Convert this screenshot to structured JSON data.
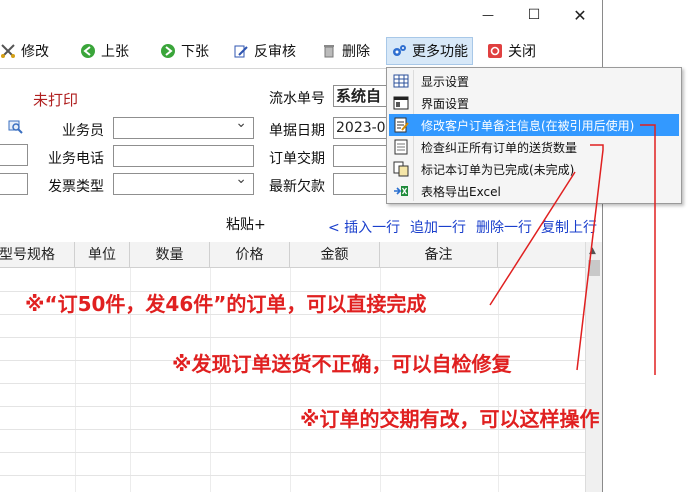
{
  "window": {
    "close_glyph": "✕",
    "max_glyph": "☐",
    "min_glyph": "—"
  },
  "toolbar": {
    "modify": "修改",
    "prev": "上张",
    "next": "下张",
    "unreview": "反审核",
    "delete": "删除",
    "more": "更多功能",
    "close": "关闭"
  },
  "form": {
    "print_status": "未打印",
    "salesman_label": "业务员",
    "salesman_value": "",
    "phone_label": "业务电话",
    "phone_value": "",
    "invoice_label": "发票类型",
    "invoice_value": "",
    "serial_label": "流水单号",
    "serial_value": "系统自",
    "date_label": "单据日期",
    "date_value": "2023-0",
    "delivery_label": "订单交期",
    "delivery_value": "",
    "debt_label": "最新欠款",
    "debt_value": ""
  },
  "grid_actions": {
    "paste": "粘贴+",
    "insert": "< 插入一行",
    "append": "追加一行",
    "delete_row": "删除一行",
    "copy_row": "复制上行"
  },
  "table": {
    "columns": [
      "型号规格",
      "单位",
      "数量",
      "价格",
      "金额",
      "备注"
    ]
  },
  "menu": {
    "items": [
      {
        "label": "显示设置",
        "icon": "grid-icon"
      },
      {
        "label": "界面设置",
        "icon": "layout-icon"
      },
      {
        "label": "修改客户订单备注信息(在被引用后使用)",
        "icon": "edit-note-icon"
      },
      {
        "label": "检查纠正所有订单的送货数量",
        "icon": "check-icon"
      },
      {
        "label": "标记本订单为已完成(未完成)",
        "icon": "mark-icon"
      },
      {
        "label": "表格导出Excel",
        "icon": "excel-icon"
      }
    ]
  },
  "annotations": {
    "complete": "※“订50件，发46件”的订单，可以直接完成",
    "fix": "※发现订单送货不正确，可以自检修复",
    "date": "※订单的交期有改，可以这样操作",
    "color": "#e02020"
  }
}
